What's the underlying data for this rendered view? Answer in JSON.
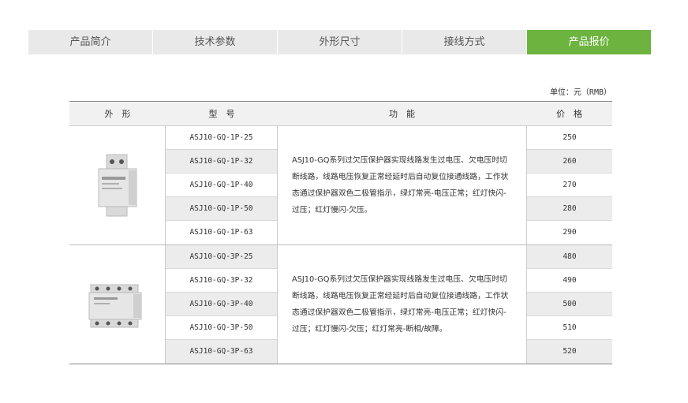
{
  "tabs": [
    {
      "label": "产品简介",
      "active": false
    },
    {
      "label": "技术参数",
      "active": false
    },
    {
      "label": "外形尺寸",
      "active": false
    },
    {
      "label": "接线方式",
      "active": false
    },
    {
      "label": "产品报价",
      "active": true
    }
  ],
  "unit_note": "单位：元（RMB）",
  "table": {
    "headers": {
      "appearance": "外　形",
      "model": "型　号",
      "function": "功　能",
      "price": "价　格"
    },
    "groups": [
      {
        "image_icon": "single-phase-protector-icon",
        "description": "ASJ10-GQ系列过欠压保护器实现线路发生过电压、欠电压时切断线路，线路电压恢复正常经延时后自动复位接通线路，工作状态通过保护器双色二极管指示，绿灯常亮-电压正常；红灯快闪-过压；红灯慢闪-欠压。",
        "rows": [
          {
            "model": "ASJ10-GQ-1P-25",
            "price": "250"
          },
          {
            "model": "ASJ10-GQ-1P-32",
            "price": "260"
          },
          {
            "model": "ASJ10-GQ-1P-40",
            "price": "270"
          },
          {
            "model": "ASJ10-GQ-1P-50",
            "price": "280"
          },
          {
            "model": "ASJ10-GQ-1P-63",
            "price": "290"
          }
        ]
      },
      {
        "image_icon": "three-phase-protector-icon",
        "description": "ASJ10-GQ系列过欠压保护器实现线路发生过电压、欠电压时切断线路，线路电压恢复正常经延时后自动复位接通线路，工作状态通过保护器双色二极管指示，绿灯常亮-电压正常；红灯快闪-过压；红灯慢闪-欠压；红灯常亮-断相/故障。",
        "rows": [
          {
            "model": "ASJ10-GQ-3P-25",
            "price": "480"
          },
          {
            "model": "ASJ10-GQ-3P-32",
            "price": "490"
          },
          {
            "model": "ASJ10-GQ-3P-40",
            "price": "500"
          },
          {
            "model": "ASJ10-GQ-3P-50",
            "price": "510"
          },
          {
            "model": "ASJ10-GQ-3P-63",
            "price": "520"
          }
        ]
      }
    ]
  },
  "colors": {
    "accent": "#6cb33f",
    "tab_bg": "#e9e9e9",
    "header_bg": "#f1f1f1",
    "row_shade": "#ececec"
  }
}
